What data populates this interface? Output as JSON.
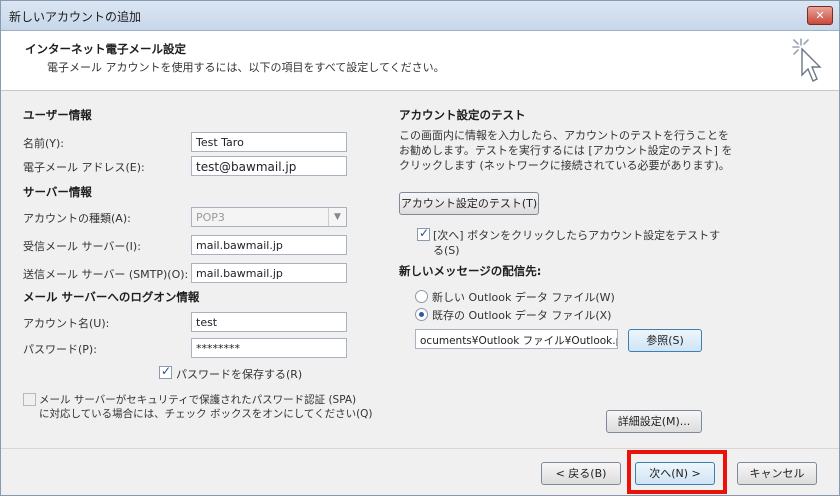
{
  "window": {
    "title": "新しいアカウントの追加",
    "close_glyph": "✕"
  },
  "header": {
    "title": "インターネット電子メール設定",
    "subtitle": "電子メール アカウントを使用するには、以下の項目をすべて設定してください。"
  },
  "user_info": {
    "heading": "ユーザー情報",
    "name_label": "名前(Y):",
    "name_value": "Test Taro",
    "email_label": "電子メール アドレス(E):",
    "email_value": "test@bawmail.jp"
  },
  "server_info": {
    "heading": "サーバー情報",
    "account_type_label": "アカウントの種類(A):",
    "account_type_value": "POP3",
    "incoming_label": "受信メール サーバー(I):",
    "incoming_value": "mail.bawmail.jp",
    "outgoing_label": "送信メール サーバー (SMTP)(O):",
    "outgoing_value": "mail.bawmail.jp"
  },
  "logon_info": {
    "heading": "メール サーバーへのログオン情報",
    "account_name_label": "アカウント名(U):",
    "account_name_value": "test",
    "password_label": "パスワード(P):",
    "password_value": "********",
    "remember_password_label": "パスワードを保存する(R)",
    "spa_label_line1": "メール サーバーがセキュリティで保護されたパスワード認証 (SPA)",
    "spa_label_line2": "に対応している場合には、チェック ボックスをオンにしてください(Q)"
  },
  "test_settings": {
    "heading": "アカウント設定のテスト",
    "desc_line1": "この画面内に情報を入力したら、アカウントのテストを行うことを",
    "desc_line2": "お勧めします。テストを実行するには [アカウント設定のテスト] を",
    "desc_line3": "クリックします (ネットワークに接続されている必要があります)。",
    "test_button": "アカウント設定のテスト(T)",
    "auto_test_line1": "[次へ] ボタンをクリックしたらアカウント設定をテストす",
    "auto_test_line2": "る(S)"
  },
  "delivery": {
    "heading": "新しいメッセージの配信先:",
    "new_data_file": "新しい Outlook データ ファイル(W)",
    "existing_data_file": "既存の Outlook データ ファイル(X)",
    "path_value": "ocuments¥Outlook ファイル¥Outlook.pst",
    "browse_button": "参照(S)"
  },
  "more_settings_button": "詳細設定(M)...",
  "footer": {
    "back_button": "< 戻る(B)",
    "next_button": "次へ(N) >",
    "cancel_button": "キャンセル"
  },
  "colors": {
    "highlight": "#e8140c",
    "title_bar": "#c7d7ea"
  }
}
